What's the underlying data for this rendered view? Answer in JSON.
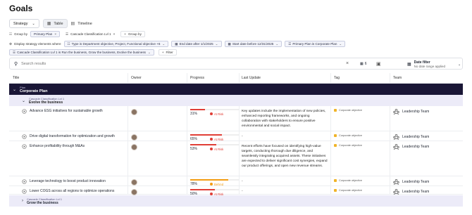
{
  "page": {
    "title": "Goals"
  },
  "toolbar": {
    "strategy": "Strategy",
    "table": "Table",
    "timeline": "Timeline"
  },
  "groupby": {
    "label": "Group by",
    "chips": [
      "Primary Plan",
      "Cascade Classification Lvl 1"
    ],
    "add": "Group by"
  },
  "filters": {
    "label": "Display strategy elements where",
    "chips": [
      "Type is Department objective, Project, Functional objective +6",
      "End date after 1/1/2025",
      "Start date before 12/31/2025",
      "Primary Plan is Corporate Plan",
      "Cascade Classification Lvl 1 is Run the business, Grow the business, Evolve the business"
    ],
    "add": "Filter"
  },
  "search": {
    "placeholder": "Search results",
    "count": "6",
    "date_filter": "Date filter",
    "date_range": "No date range applied"
  },
  "columns": {
    "title": "Title",
    "owner": "Owner",
    "progress": "Progress",
    "update": "Last Update",
    "tag": "Tag",
    "team": "Team"
  },
  "plan": {
    "small": "Plan",
    "name": "Corporate Plan"
  },
  "group1": {
    "small": "Cascade Classification Lvl 1",
    "name": "Evolve the business"
  },
  "group2": {
    "small": "Cascade Classification Lvl 1",
    "name": "Grow the business"
  },
  "rows": [
    {
      "title": "Advance ESG initiatives for sustainable growth",
      "progress": "31%",
      "pct": 31,
      "status": "At Risk",
      "status_color": "#e03e36",
      "update": "Key updates include the implementation of new policies, enhanced reporting frameworks, and ongoing collaboration with stakeholders to ensure positive environmental and social impact.",
      "tag": "Corporate objective",
      "team": "Leadership Team"
    },
    {
      "title": "Drive digital transformation for optimization and growth",
      "progress": "65%",
      "pct": 65,
      "status": "At Risk",
      "status_color": "#e03e36",
      "update": "-",
      "tag": "Corporate objective",
      "team": "Leadership Team"
    },
    {
      "title": "Enhance profitability through M&As",
      "progress": "53%",
      "pct": 53,
      "status": "At Risk",
      "status_color": "#e03e36",
      "update": "Recent efforts have focused on identifying high-value targets, conducting thorough due diligence, and seamlessly integrating acquired assets. These initiatives are expected to deliver significant cost synergies, expand our product offerings, and open new revenue streams.",
      "tag": "Corporate objective",
      "team": "Leadership Team"
    },
    {
      "title": "Leverage technology to boost product innovation",
      "progress": "78%",
      "pct": 78,
      "status": "Behind",
      "status_color": "#f39c12",
      "update": "-",
      "tag": "Corporate objective",
      "team": "Leadership Team"
    },
    {
      "title": "Lower COGS across all regions to optimize operations",
      "progress": "50%",
      "pct": 50,
      "status": "At Risk",
      "status_color": "#e03e36",
      "update": "-",
      "tag": "Corporate objective",
      "team": "Leadership Team"
    }
  ]
}
